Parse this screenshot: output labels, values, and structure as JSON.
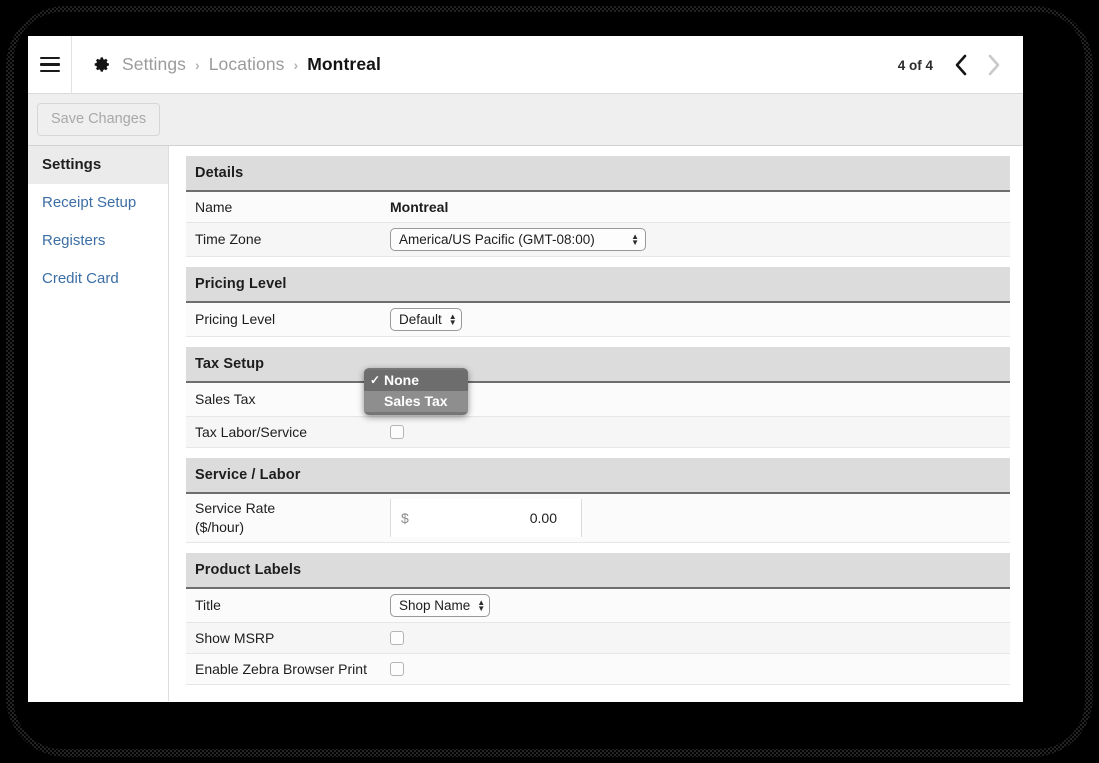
{
  "header": {
    "menu_icon": "hamburger-icon",
    "app_icon": "gear-icon",
    "breadcrumb": [
      "Settings",
      "Locations",
      "Montreal"
    ],
    "breadcrumb_separator": "›",
    "pager_count": "4 of 4",
    "prev_icon": "chevron-left-icon",
    "next_icon": "chevron-right-icon"
  },
  "toolbar": {
    "save_label": "Save Changes"
  },
  "sidebar": {
    "items": [
      {
        "label": "Settings",
        "active": true
      },
      {
        "label": "Receipt Setup",
        "active": false
      },
      {
        "label": "Registers",
        "active": false
      },
      {
        "label": "Credit Card",
        "active": false
      }
    ]
  },
  "sections": {
    "details": {
      "title": "Details",
      "name_label": "Name",
      "name_value": "Montreal",
      "timezone_label": "Time Zone",
      "timezone_value": "America/US Pacific (GMT-08:00)"
    },
    "pricing": {
      "title": "Pricing Level",
      "level_label": "Pricing Level",
      "level_value": "Default"
    },
    "tax": {
      "title": "Tax Setup",
      "sales_tax_label": "Sales Tax",
      "tax_labor_label": "Tax Labor/Service"
    },
    "service": {
      "title": "Service / Labor",
      "rate_label_line1": "Service Rate",
      "rate_label_line2": "($/hour)",
      "currency_symbol": "$",
      "rate_value": "0.00"
    },
    "product_labels": {
      "title": "Product Labels",
      "title_label": "Title",
      "title_value": "Shop Name",
      "msrp_label": "Show MSRP",
      "zebra_label": "Enable Zebra Browser Print"
    }
  },
  "dropdown": {
    "open": true,
    "check_glyph": "✓",
    "options": [
      {
        "label": "None",
        "selected": true,
        "hovered": false
      },
      {
        "label": "Sales Tax",
        "selected": false,
        "hovered": true
      }
    ]
  },
  "colors": {
    "link": "#3b6ea5",
    "section_header_bg": "#dcdcdc",
    "dropdown_bg": "#767676",
    "dropdown_hover": "#8e8e8e"
  }
}
